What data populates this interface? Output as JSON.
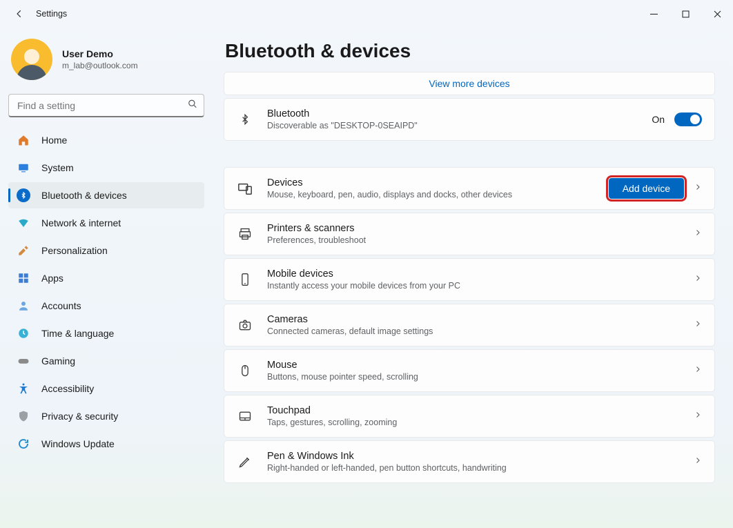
{
  "app_title": "Settings",
  "profile": {
    "name": "User Demo",
    "email": "m_lab@outlook.com"
  },
  "search": {
    "placeholder": "Find a setting"
  },
  "nav": {
    "items": [
      {
        "label": "Home"
      },
      {
        "label": "System"
      },
      {
        "label": "Bluetooth & devices"
      },
      {
        "label": "Network & internet"
      },
      {
        "label": "Personalization"
      },
      {
        "label": "Apps"
      },
      {
        "label": "Accounts"
      },
      {
        "label": "Time & language"
      },
      {
        "label": "Gaming"
      },
      {
        "label": "Accessibility"
      },
      {
        "label": "Privacy & security"
      },
      {
        "label": "Windows Update"
      }
    ],
    "active_index": 2
  },
  "page": {
    "title": "Bluetooth & devices",
    "link_more": "View more devices",
    "bluetooth": {
      "title": "Bluetooth",
      "sub": "Discoverable as \"DESKTOP-0SEAIPD\"",
      "state_label": "On"
    },
    "sections": [
      {
        "title": "Devices",
        "sub": "Mouse, keyboard, pen, audio, displays and docks, other devices",
        "button": "Add device"
      },
      {
        "title": "Printers & scanners",
        "sub": "Preferences, troubleshoot"
      },
      {
        "title": "Mobile devices",
        "sub": "Instantly access your mobile devices from your PC"
      },
      {
        "title": "Cameras",
        "sub": "Connected cameras, default image settings"
      },
      {
        "title": "Mouse",
        "sub": "Buttons, mouse pointer speed, scrolling"
      },
      {
        "title": "Touchpad",
        "sub": "Taps, gestures, scrolling, zooming"
      },
      {
        "title": "Pen & Windows Ink",
        "sub": "Right-handed or left-handed, pen button shortcuts, handwriting"
      }
    ]
  }
}
